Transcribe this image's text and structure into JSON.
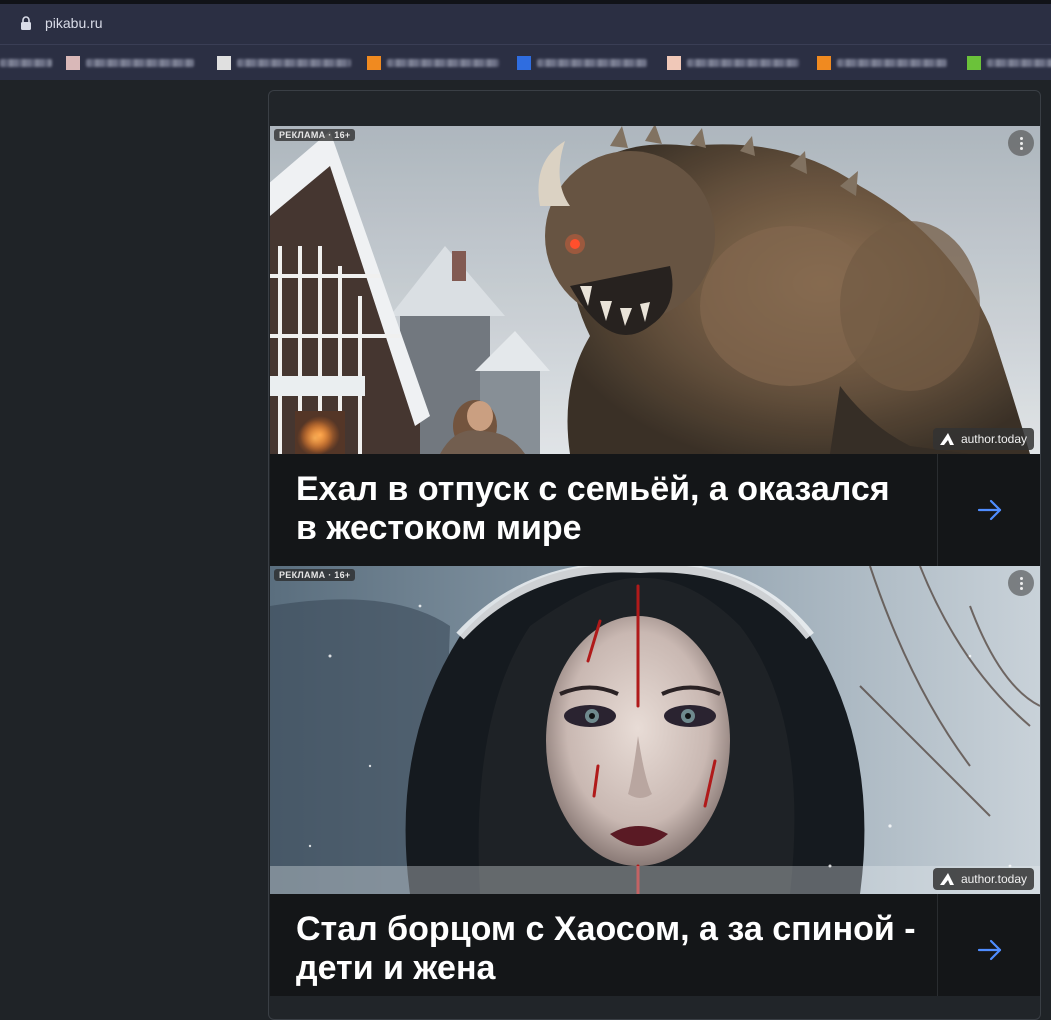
{
  "browser": {
    "url": "pikabu.ru",
    "bookmarks": [
      {
        "favicon_color": "#ffffff"
      },
      {
        "favicon_color": "#d9b8b8"
      },
      {
        "favicon_color": "#e0e0e0"
      },
      {
        "favicon_color": "#f08a20"
      },
      {
        "favicon_color": "#2f6de0"
      },
      {
        "favicon_color": "#f0c8b8"
      },
      {
        "favicon_color": "#f08a20"
      },
      {
        "favicon_color": "#6bc23a"
      }
    ]
  },
  "feed": {
    "ads": [
      {
        "badge": "РЕКЛАМА · 16+",
        "source": "author.today",
        "title": "Ехал в отпуск с семьёй, а оказался в жестоком мире"
      },
      {
        "badge": "РЕКЛАМА · 16+",
        "source": "author.today",
        "title": "Стал борцом с Хаосом, а за спиной - дети и жена"
      }
    ]
  },
  "colors": {
    "accent_arrow": "#4f8dff",
    "page_bg": "#1f2327",
    "browser_chrome": "#2b2f43"
  }
}
